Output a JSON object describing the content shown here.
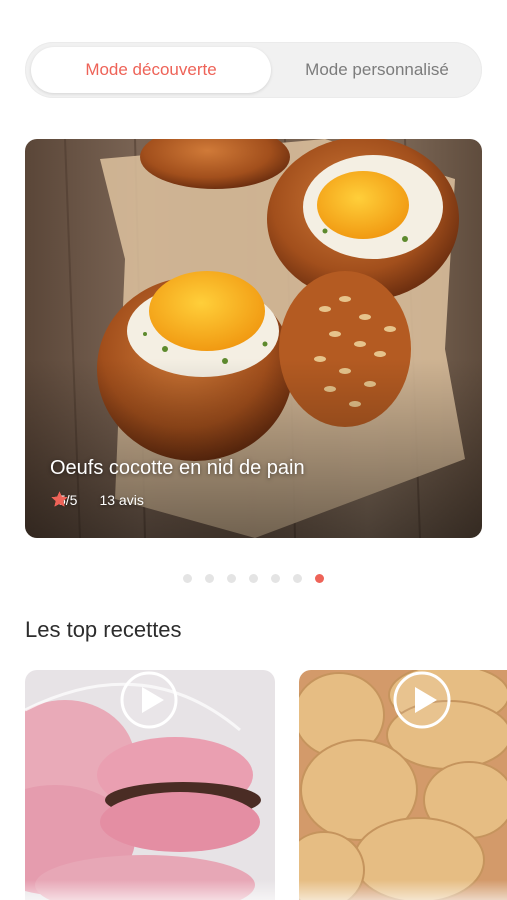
{
  "mode_switch": {
    "options": [
      "Mode découverte",
      "Mode personnalisé"
    ],
    "selected": "Mode découverte"
  },
  "featured_recipe": {
    "title": "Oeufs cocotte en nid de pain",
    "rating": 5,
    "rating_text": "5/5",
    "reviews": "13 avis",
    "image": "eggs-in-bread-bowls"
  },
  "carousel": {
    "total": 7,
    "active_index": 6
  },
  "top_recipes": {
    "title": "Les top recettes",
    "items": [
      {
        "image": "pink-macarons",
        "icon": "play-icon"
      },
      {
        "image": "cookies",
        "icon": "play-icon"
      }
    ]
  },
  "colors": {
    "accent": "#ee6358",
    "text": "#2d2d2d",
    "muted": "#7c7c7c",
    "segment_bg": "#f1f1f1"
  }
}
